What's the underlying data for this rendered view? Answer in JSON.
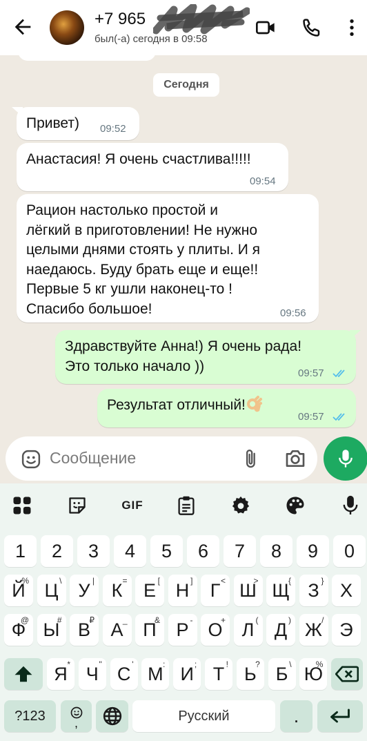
{
  "header": {
    "contact_name": "+7 965",
    "status": "был(-а) сегодня в 09:58",
    "icons": [
      "back-arrow-icon",
      "avatar",
      "video-call-icon",
      "phone-icon",
      "more-vert-icon"
    ]
  },
  "chat": {
    "date_chip": "Сегодня",
    "messages": [
      {
        "direction": "in",
        "text": "Привет)",
        "time": "09:52"
      },
      {
        "direction": "in",
        "text": "Анастасия! Я очень счастлива!!!!!",
        "time": "09:54"
      },
      {
        "direction": "in",
        "text": "Рацион настолько простой и\nлёгкий в приготовлении! Не нужно\nцелыми днями стоять у плиты. И я\nнаедаюсь. Буду брать еще и еще!!\nПервые 5 кг  ушли наконец-то !\nСпасибо большое!",
        "time": "09:56"
      },
      {
        "direction": "out",
        "text": "Здравствуйте Анна!) Я очень рада!\nЭто только начало ))",
        "time": "09:57",
        "status": "read"
      },
      {
        "direction": "out",
        "text": "Результат отличный!",
        "emoji": "ok-hand-emoji",
        "time": "09:57",
        "status": "read"
      }
    ]
  },
  "composer": {
    "placeholder": "Сообщение",
    "icons": [
      "emoji-icon",
      "attach-icon",
      "camera-icon",
      "mic-icon"
    ]
  },
  "keyboard": {
    "toolbar_icons": [
      "apps-grid-icon",
      "sticker-icon",
      "gif-icon",
      "clipboard-icon",
      "settings-gear-icon",
      "palette-icon",
      "mic-icon"
    ],
    "gif_label": "GIF",
    "number_row": [
      "1",
      "2",
      "3",
      "4",
      "5",
      "6",
      "7",
      "8",
      "9",
      "0"
    ],
    "row1": [
      [
        "Й",
        "%"
      ],
      [
        "Ц",
        "\\"
      ],
      [
        "У",
        "|"
      ],
      [
        "К",
        "="
      ],
      [
        "Е",
        "["
      ],
      [
        "Н",
        "]"
      ],
      [
        "Г",
        "<"
      ],
      [
        "Ш",
        ">"
      ],
      [
        "Щ",
        "{"
      ],
      [
        "З",
        "}"
      ],
      [
        "Х",
        ""
      ]
    ],
    "row2": [
      [
        "Ф",
        "@"
      ],
      [
        "Ы",
        "#"
      ],
      [
        "В",
        "₽"
      ],
      [
        "А",
        "_"
      ],
      [
        "П",
        "&"
      ],
      [
        "Р",
        "-"
      ],
      [
        "О",
        "+"
      ],
      [
        "Л",
        "("
      ],
      [
        "Д",
        ")"
      ],
      [
        "Ж",
        "/"
      ],
      [
        "Э",
        ""
      ]
    ],
    "row3": [
      [
        "Я",
        "*"
      ],
      [
        "Ч",
        "\""
      ],
      [
        "С",
        "'"
      ],
      [
        "М",
        ":"
      ],
      [
        "И",
        ";"
      ],
      [
        "Т",
        "!"
      ],
      [
        "Ь",
        "?"
      ],
      [
        "Б",
        "\\"
      ],
      [
        "Ю",
        "%"
      ]
    ],
    "symbols_key": "?123",
    "emoji_key_sub": ",",
    "space_label": "Русский",
    "period_key": ".",
    "colors": {
      "send_green": "#1daa61",
      "bubble_out": "#d9fdd3",
      "read_tick": "#53bdeb"
    }
  }
}
